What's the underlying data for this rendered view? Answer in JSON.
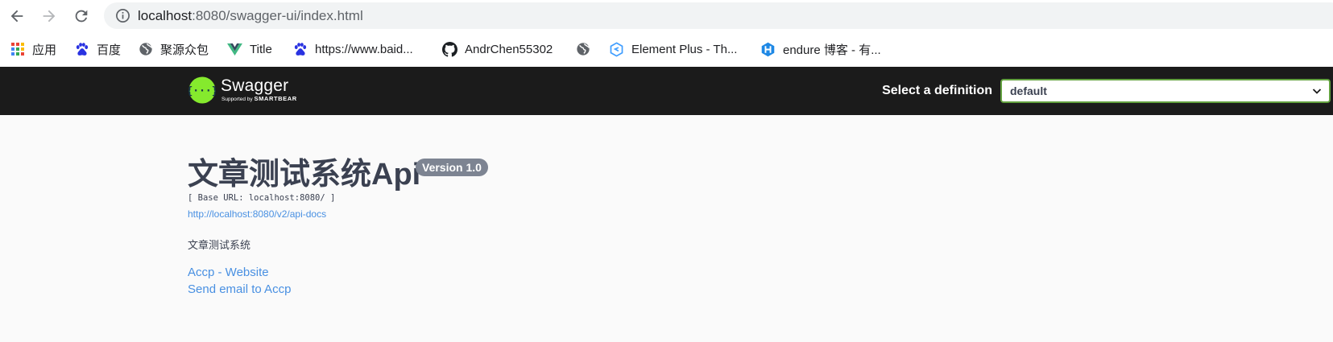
{
  "browser": {
    "url_host": "localhost",
    "url_path": ":8080/swagger-ui/index.html"
  },
  "bookmarks": [
    {
      "label": "应用",
      "icon": "apps-grid-icon"
    },
    {
      "label": "百度",
      "icon": "baidu-icon"
    },
    {
      "label": "聚源众包",
      "icon": "globe-icon"
    },
    {
      "label": "Title",
      "icon": "vue-icon"
    },
    {
      "label": "https://www.baid...",
      "icon": "baidu-icon"
    },
    {
      "label": "AndrChen55302",
      "icon": "github-icon"
    },
    {
      "label": "",
      "icon": "globe-icon"
    },
    {
      "label": "Element Plus - Th...",
      "icon": "element-plus-icon"
    },
    {
      "label": "endure 博客 - 有...",
      "icon": "hexagon-h-icon"
    }
  ],
  "swagger": {
    "logo_name": "Swagger",
    "logo_supported_by": "Supported by",
    "logo_brand": "SMARTBEAR",
    "definition_label": "Select a definition",
    "definition_value": "default"
  },
  "info": {
    "title": "文章测试系统Api",
    "version": "Version 1.0",
    "base_url": "[ Base URL: localhost:8080/ ]",
    "api_docs_link": "http://localhost:8080/v2/api-docs",
    "description": "文章测试系统",
    "website_link": "Accp - Website",
    "email_link": "Send email to Accp"
  },
  "colors": {
    "topbar": "#1b1b1b",
    "swagger_green": "#85ea2d",
    "select_border": "#62a03f",
    "link": "#4990e2",
    "badge": "#7d8492",
    "text": "#3b4151"
  }
}
